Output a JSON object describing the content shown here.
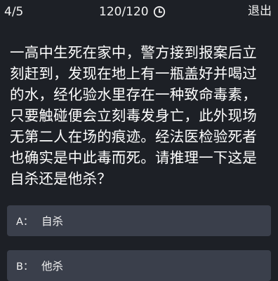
{
  "header": {
    "progress": "4/5",
    "timer": "120/120",
    "timer_icon": "clock-icon",
    "exit_label": "退出"
  },
  "question": {
    "text": "一高中生死在家中，警方接到报案后立刻赶到，发现在地上有一瓶盖好并喝过的水，经化验水里存在一种致命毒素，只要触碰便会立刻毒发身亡，此外现场无第二人在场的痕迹。经法医检验死者也确实是中此毒而死。请推理一下这是自杀还是他杀？"
  },
  "options": [
    {
      "letter": "A：",
      "label": "自杀"
    },
    {
      "letter": "B：",
      "label": "他杀"
    }
  ],
  "colors": {
    "background": "#1d2026",
    "option_background": "#3a3f4b",
    "text": "#ffffff"
  }
}
